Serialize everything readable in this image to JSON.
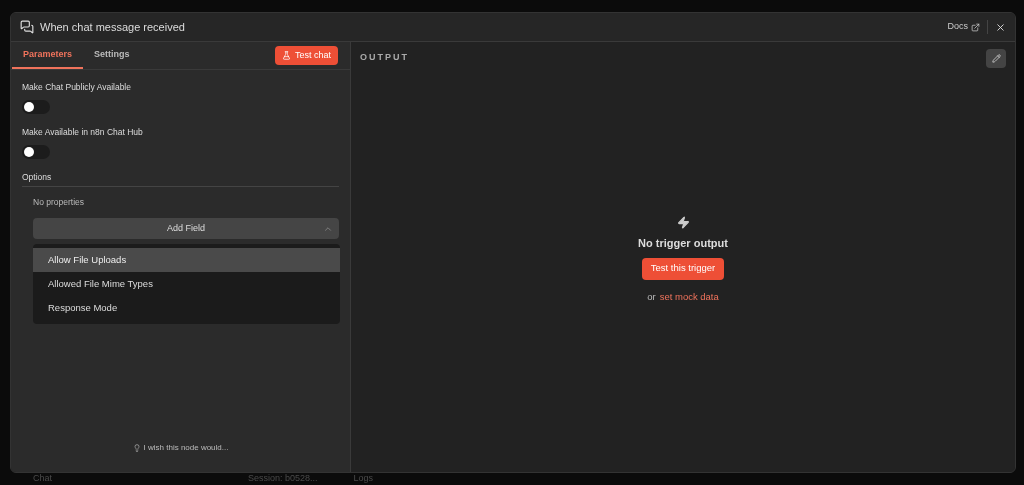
{
  "window": {
    "title": "When chat message received",
    "docs_link": "Docs"
  },
  "tabs": [
    {
      "label": "Parameters",
      "selected": true
    },
    {
      "label": "Settings",
      "selected": false
    }
  ],
  "test_chat_button": "Test chat",
  "toggles": [
    {
      "label": "Make Chat Publicly Available",
      "on": false
    },
    {
      "label": "Make Available in n8n Chat Hub",
      "on": false
    }
  ],
  "options": {
    "heading": "Options",
    "empty_text": "No properties",
    "add_field_button": "Add Field",
    "expanded": true,
    "menu_items": [
      {
        "label": "Allow File Uploads",
        "selected": true
      },
      {
        "label": "Allowed File Mime Types",
        "selected": false
      },
      {
        "label": "Response Mode",
        "selected": false
      }
    ]
  },
  "feedback_link": "I wish this node would...",
  "output": {
    "heading": "OUTPUT",
    "empty_title": "No trigger output",
    "test_button": "Test this trigger",
    "alt_prefix": "or",
    "mock_link": "set mock data"
  },
  "background_bar": {
    "chat_label": "Chat",
    "session": "Session: b0528...",
    "logs_label": "Logs"
  }
}
